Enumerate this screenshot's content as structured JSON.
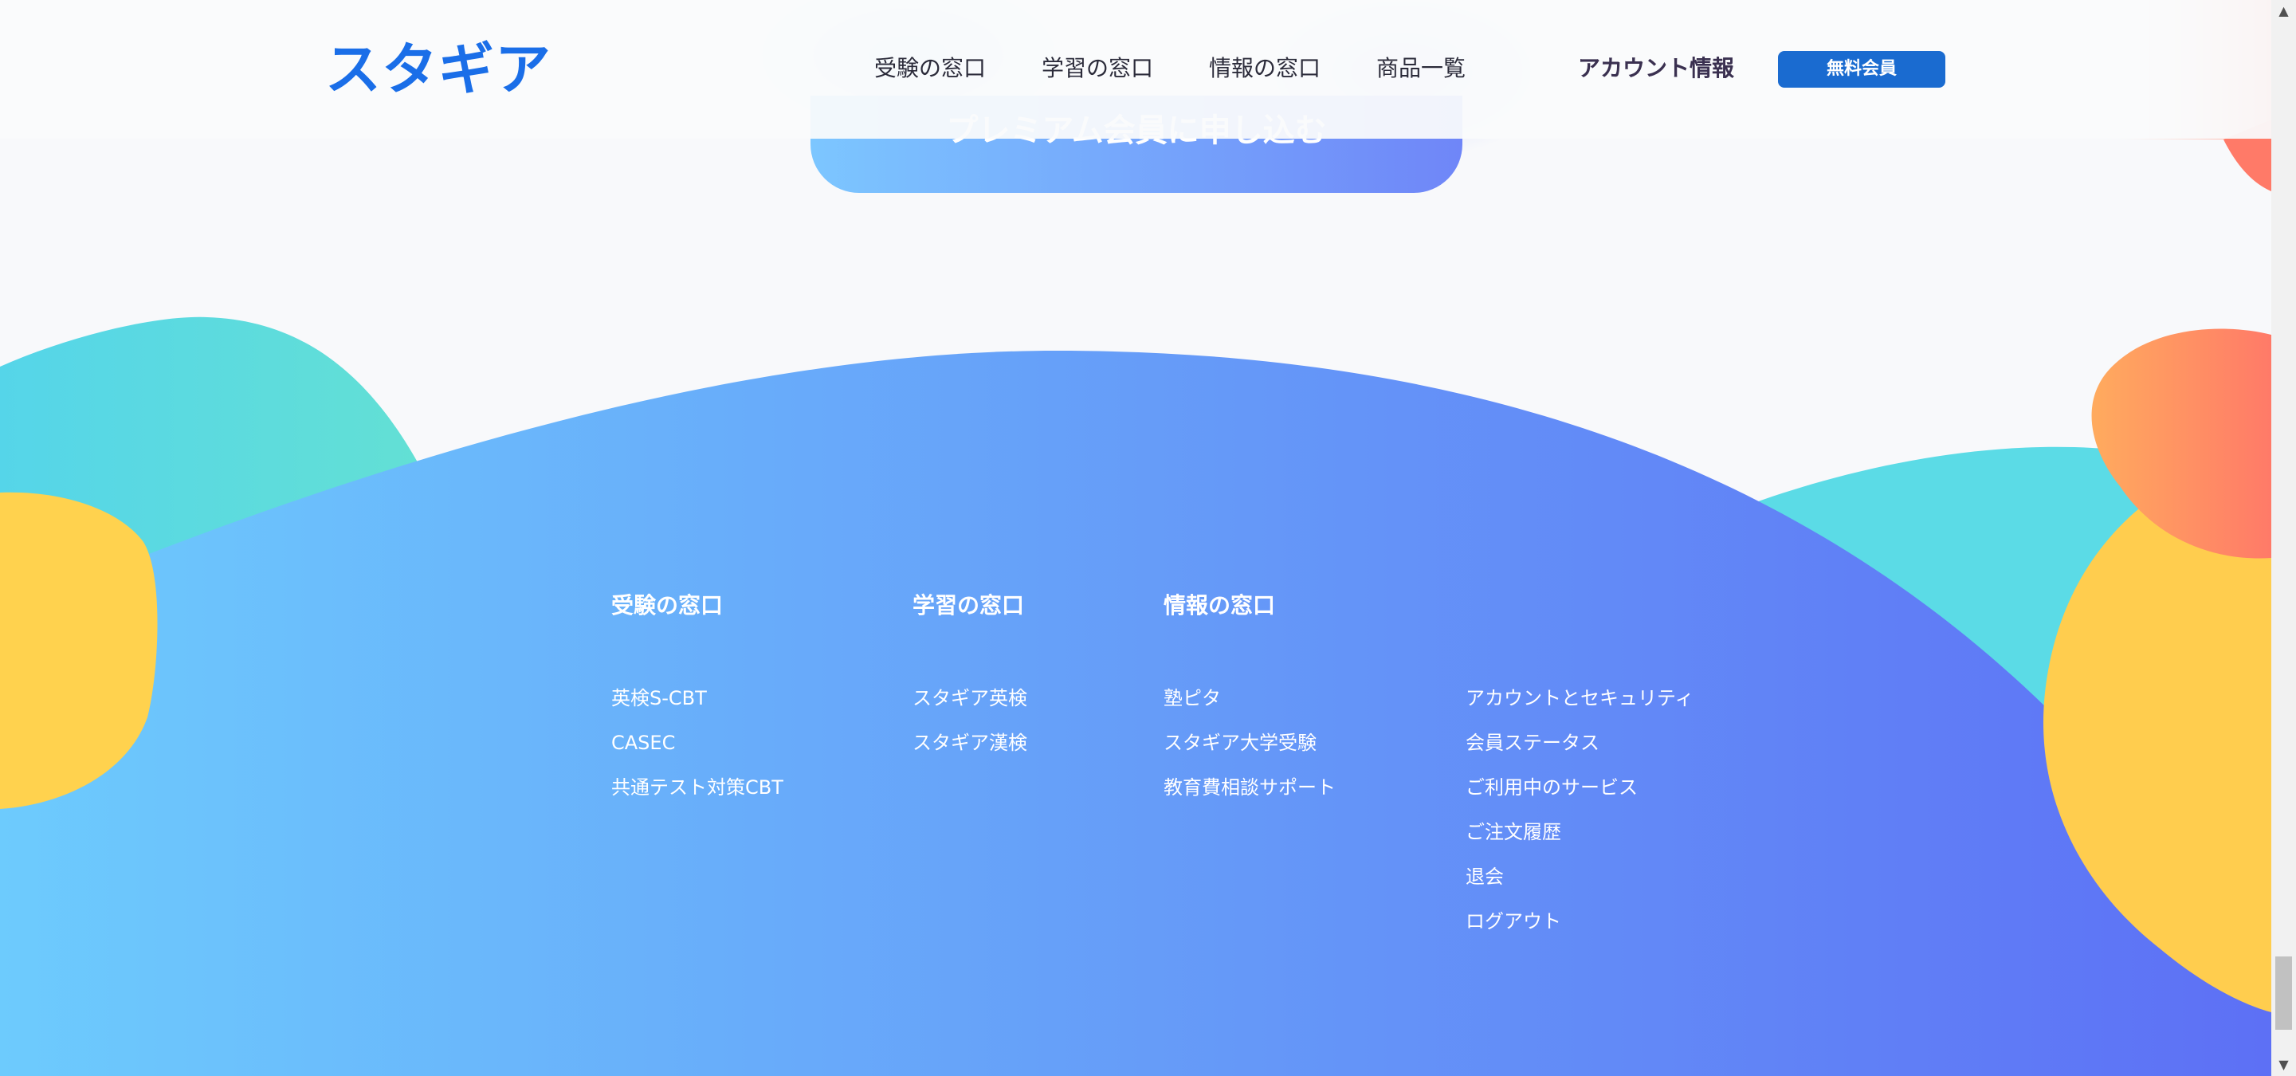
{
  "header": {
    "logo": "スタギア",
    "nav": [
      {
        "label": "受験の窓口"
      },
      {
        "label": "学習の窓口"
      },
      {
        "label": "情報の窓口"
      },
      {
        "label": "商品一覧"
      }
    ],
    "account_label": "アカウント情報",
    "member_button": "無料会員"
  },
  "cta": {
    "label": "プレミアム会員に申し込む"
  },
  "footer": {
    "columns": [
      {
        "heading": "受験の窓口",
        "links": [
          "英検S-CBT",
          "CASEC",
          "共通テスト対策CBT"
        ]
      },
      {
        "heading": "学習の窓口",
        "links": [
          "スタギア英検",
          "スタギア漢検"
        ]
      },
      {
        "heading": "情報の窓口",
        "links": [
          "塾ピタ",
          "スタギア大学受験",
          "教育費相談サポート"
        ]
      },
      {
        "heading": "",
        "links": [
          "アカウントとセキュリティ",
          "会員ステータス",
          "ご利用中のサービス",
          "ご注文履歴",
          "退会",
          "ログアウト"
        ]
      }
    ]
  },
  "colors": {
    "brand": "#1a6ee8",
    "button": "#1a6bd0",
    "footer_gradient_start": "#6cc8fc",
    "footer_gradient_end": "#5f76f6",
    "teal_blob": "#5ad8e4",
    "yellow_blob": "#ffd04e",
    "orange_blob": "#ff8260"
  },
  "icons": {
    "scroll_up": "scroll-up-arrow-icon",
    "scroll_down": "scroll-down-arrow-icon"
  }
}
